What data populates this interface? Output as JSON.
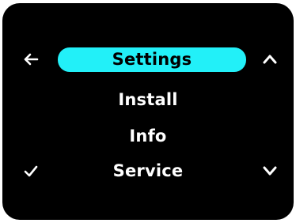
{
  "menu": {
    "items": [
      {
        "label": "Settings",
        "selected": true
      },
      {
        "label": "Install",
        "selected": false
      },
      {
        "label": "Info",
        "selected": false
      },
      {
        "label": "Service",
        "selected": false
      }
    ]
  },
  "icons": {
    "back": "left-arrow-icon",
    "up": "chevron-up-icon",
    "down": "chevron-down-icon",
    "confirm": "checkmark-icon"
  },
  "colors": {
    "screen_background": "#000000",
    "highlight": "#22f0f8",
    "text": "#ffffff",
    "selected_text": "#000000"
  }
}
